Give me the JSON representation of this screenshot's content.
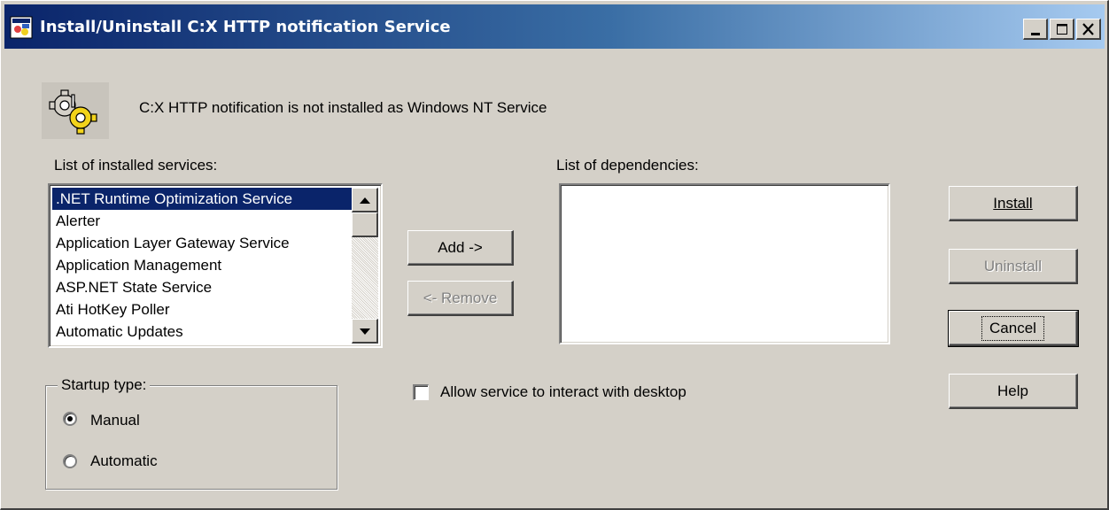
{
  "window": {
    "title": "Install/Uninstall C:X HTTP notification Service",
    "app_icon": "service-config-icon",
    "controls": [
      "minimize-icon",
      "maximize-icon",
      "close-icon"
    ]
  },
  "status": {
    "icon": "gears-icon",
    "message": "C:X HTTP notification is not installed as Windows NT Service"
  },
  "installed_services": {
    "label": "List of installed services:",
    "items": [
      ".NET Runtime Optimization Service",
      "Alerter",
      "Application Layer Gateway Service",
      "Application Management",
      "ASP.NET State Service",
      "Ati HotKey Poller",
      "Automatic Updates"
    ],
    "selected": ".NET Runtime Optimization Service"
  },
  "dependencies": {
    "label": "List of dependencies:",
    "items": []
  },
  "buttons": {
    "add": "Add ->",
    "remove": "<- Remove",
    "install": "Install",
    "uninstall": "Uninstall",
    "cancel": "Cancel",
    "help": "Help"
  },
  "startup_type": {
    "label": "Startup type:",
    "options": [
      "Manual",
      "Automatic"
    ],
    "selected": "Manual"
  },
  "interact_desktop": {
    "label": "Allow service to interact with desktop",
    "checked": false
  },
  "colors": {
    "face": "#d4d0c8",
    "title_start": "#0a246a",
    "title_end": "#a6caf0",
    "selection": "#0a246a"
  }
}
